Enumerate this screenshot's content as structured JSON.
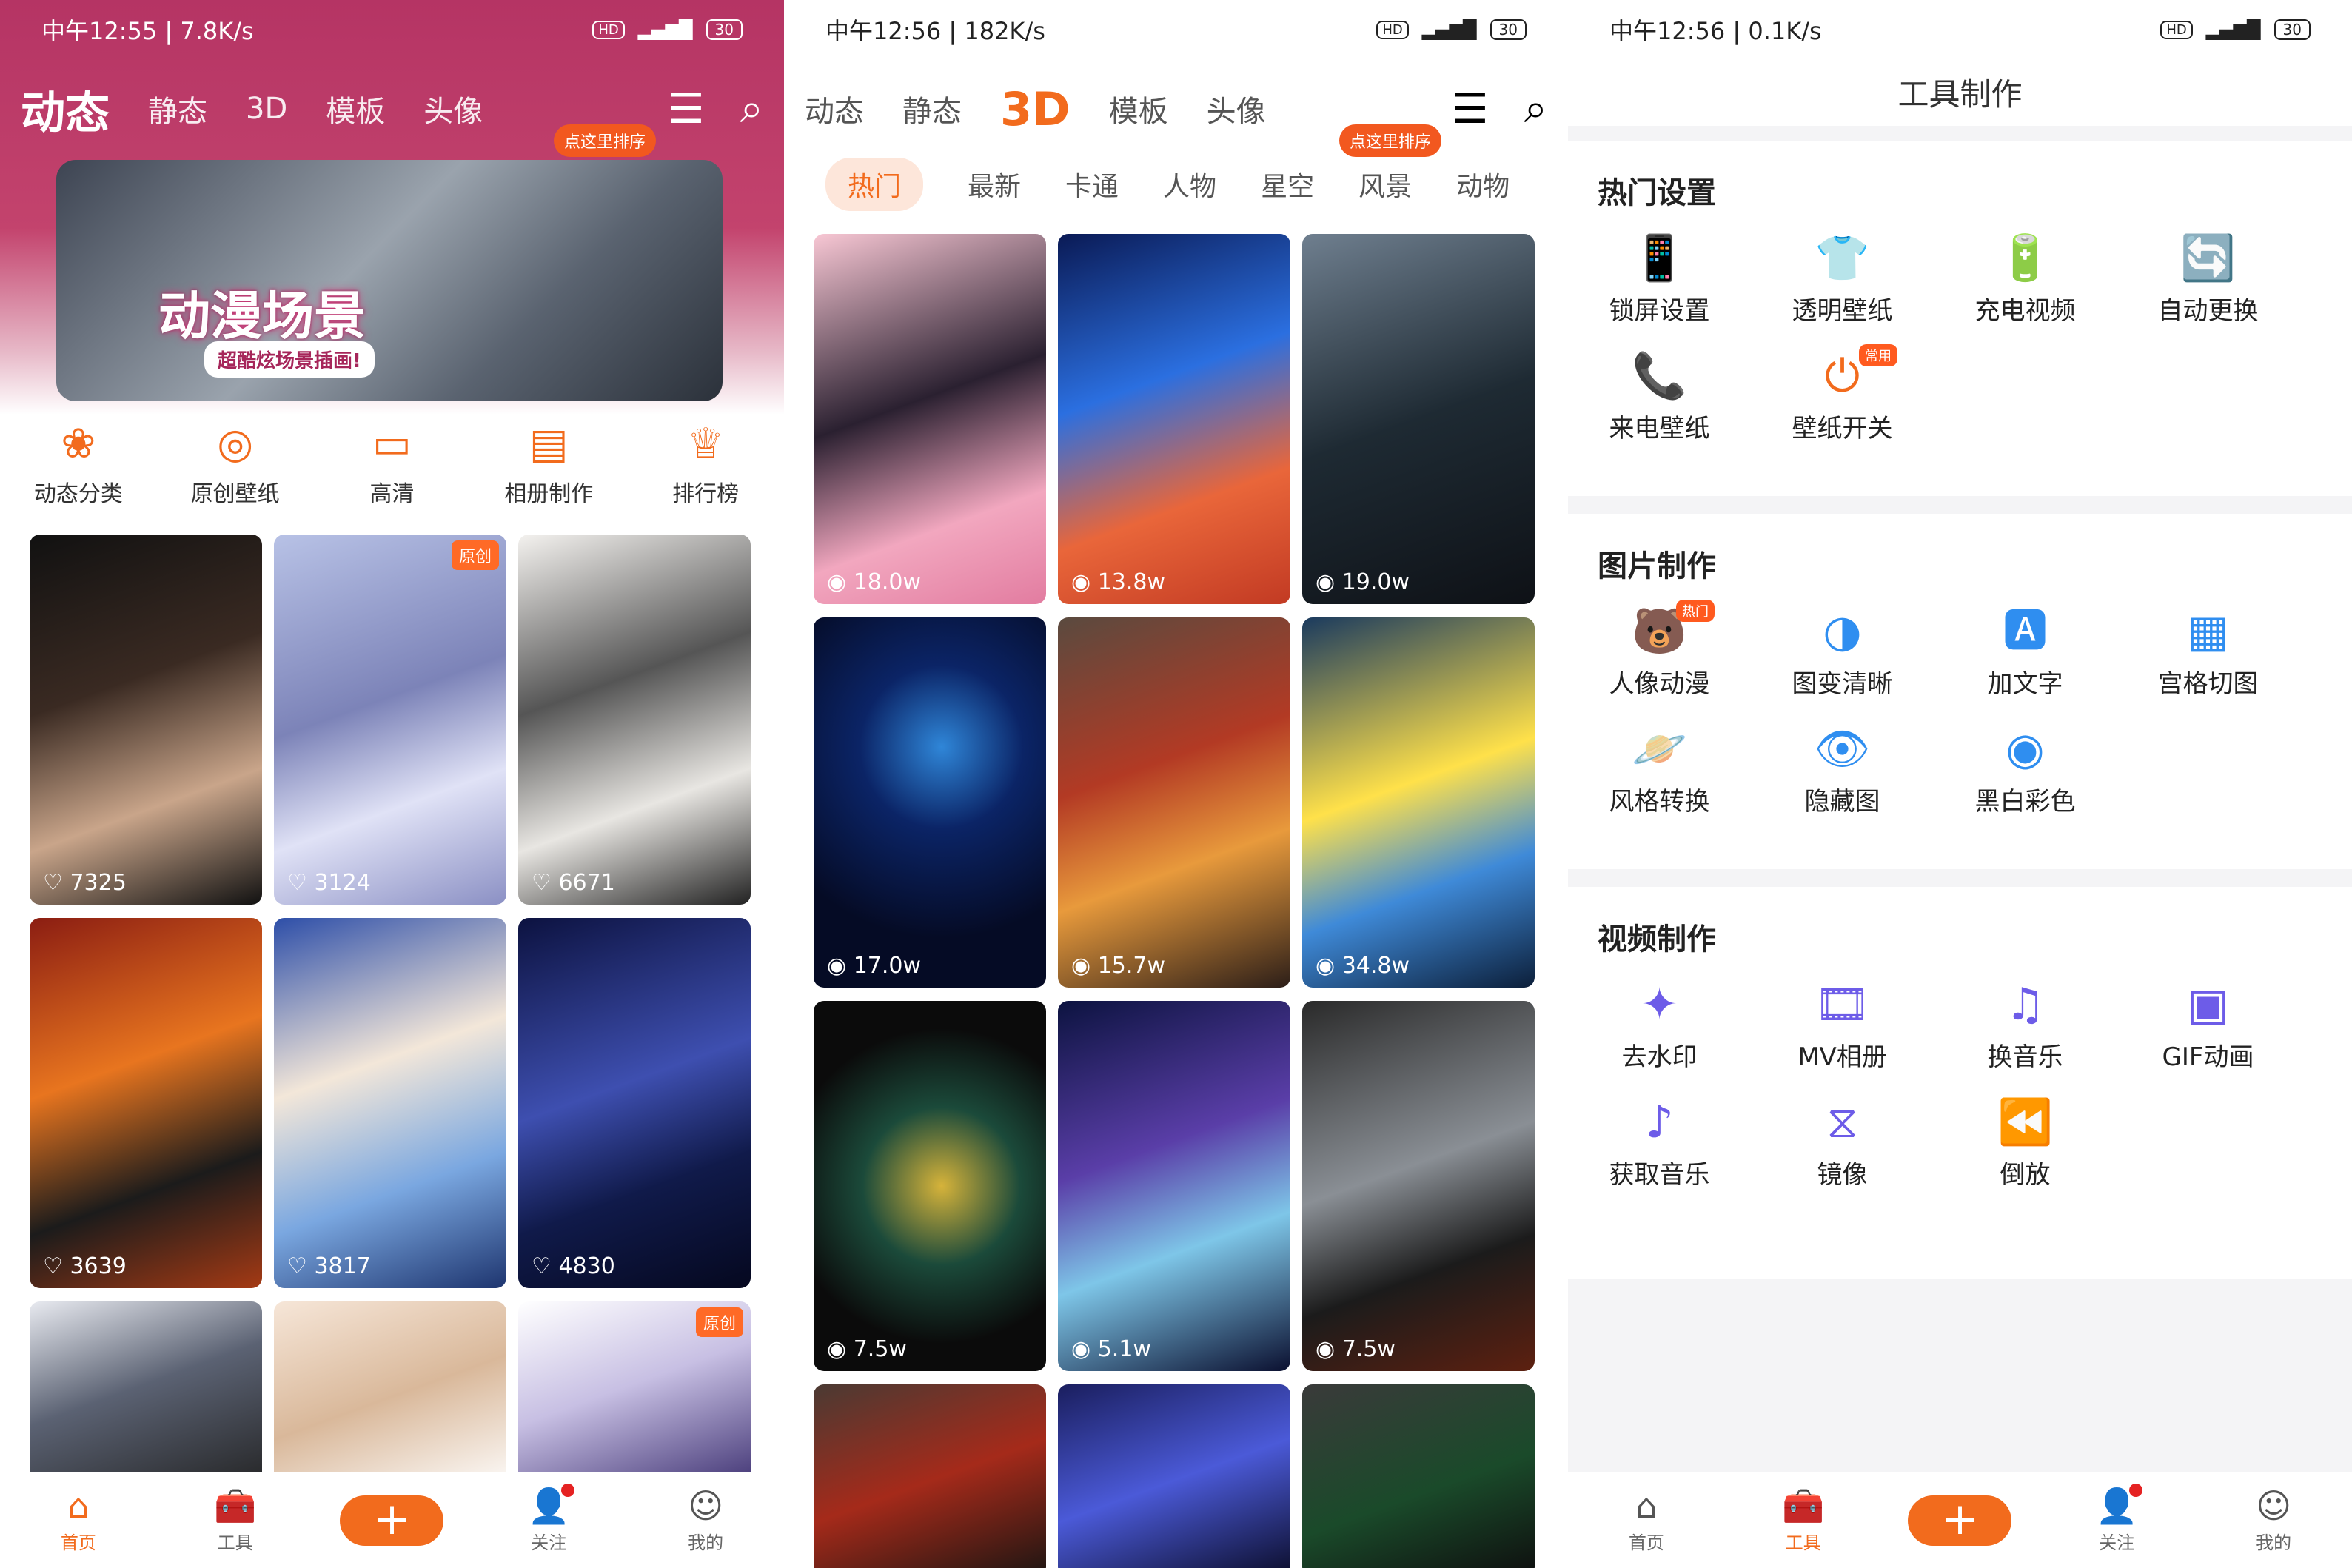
{
  "panel1": {
    "status": {
      "left": "中午12:55 | 7.8K/s",
      "battery": "30"
    },
    "tabs": [
      "动态",
      "静态",
      "3D",
      "模板",
      "头像"
    ],
    "sort_badge": "点这里排序",
    "banner": {
      "title": "动漫场景",
      "subtitle": "超酷炫场景插画!"
    },
    "categories": [
      {
        "label": "动态分类",
        "icon": "grid-icon"
      },
      {
        "label": "原创壁纸",
        "icon": "bulb-icon"
      },
      {
        "label": "高清",
        "icon": "hd-icon"
      },
      {
        "label": "相册制作",
        "icon": "film-icon"
      },
      {
        "label": "排行榜",
        "icon": "trophy-icon"
      }
    ],
    "cards": [
      {
        "likes": "7325",
        "original": "",
        "bg": "linear-gradient(160deg,#111,#3a2a22 40%,#c9a58a 70%,#111)"
      },
      {
        "likes": "3124",
        "original": "原创",
        "bg": "linear-gradient(160deg,#b8c2e6,#7c83b8 45%,#e0e2f6 70%,#8b90c4)"
      },
      {
        "likes": "6671",
        "original": "",
        "bg": "linear-gradient(160deg,#f4f2ef,#555 40%,#e8e6e2 70%,#222)"
      },
      {
        "likes": "3639",
        "original": "",
        "bg": "linear-gradient(160deg,#8b1d12,#e8751f 40%,#1b1b1b 70%,#a53a14)"
      },
      {
        "likes": "3817",
        "original": "",
        "bg": "linear-gradient(160deg,#2d4ea8,#f3e7d9 40%,#7aa7e0 70%,#1e356f)"
      },
      {
        "likes": "4830",
        "original": "",
        "bg": "linear-gradient(160deg,#0c1240,#3e4fb0 45%,#101a4a 70%,#05081f)"
      },
      {
        "likes": "",
        "original": "",
        "bg": "linear-gradient(160deg,#e8eaf0,#5b6273 45%,#222)"
      },
      {
        "likes": "",
        "original": "",
        "bg": "linear-gradient(160deg,#f6e6d8,#d9b89a 50%,#fff)"
      },
      {
        "likes": "",
        "original": "原创",
        "bg": "linear-gradient(160deg,#fff,#c7bfe3 45%,#3a2d6e)"
      }
    ]
  },
  "panel2": {
    "status": {
      "left": "中午12:56 | 182K/s",
      "battery": "30"
    },
    "tabs": [
      "动态",
      "静态",
      "3D",
      "模板",
      "头像"
    ],
    "sort_badge": "点这里排序",
    "subtabs": [
      "热门",
      "最新",
      "卡通",
      "人物",
      "星空",
      "风景",
      "动物"
    ],
    "cards": [
      {
        "views": "18.0w",
        "bg": "linear-gradient(160deg,#f8c7d4,#2a2030 45%,#f2a7bf 75%,#e27ca0)"
      },
      {
        "views": "13.8w",
        "bg": "linear-gradient(160deg,#0a1a55,#2b6fe0 40%,#e9663a 70%,#c23a23)"
      },
      {
        "views": "19.0w",
        "bg": "linear-gradient(160deg,#6f7f8f,#1e2a33 50%,#0e1116)"
      },
      {
        "views": "17.0w",
        "bg": "radial-gradient(circle at 55% 35%,#2f86d8 0%,#0b2466 30%,#050b25 70%)"
      },
      {
        "views": "15.7w",
        "bg": "linear-gradient(160deg,#5a4a3f,#b33a24 40%,#e89a3c 65%,#2c1e18)"
      },
      {
        "views": "34.8w",
        "bg": "linear-gradient(160deg,#1a3a5e,#ffe14a 45%,#3f8ad8 70%,#0c1f3a)"
      },
      {
        "views": "7.5w",
        "bg": "radial-gradient(circle at 55% 50%,#d6b33a 0%,#1b4a3a 35%,#0b0b0b 70%)"
      },
      {
        "views": "5.1w",
        "bg": "linear-gradient(160deg,#0c1340,#5a3ea8 40%,#7ec6e8 65%,#0b1030)"
      },
      {
        "views": "7.5w",
        "bg": "linear-gradient(160deg,#2a2a2a,#8a8f95 45%,#1b1b1b 70%,#5d2010)"
      },
      {
        "views": "",
        "bg": "linear-gradient(160deg,#4a3a33,#a52a1a 50%,#1c1512)"
      },
      {
        "views": "",
        "bg": "linear-gradient(160deg,#1a1e5e,#4b5ad8 50%,#0b0d2a)"
      },
      {
        "views": "",
        "bg": "linear-gradient(160deg,#3a3a3a,#1a4a2a 55%,#0e0e0e)"
      }
    ]
  },
  "panel3": {
    "status": {
      "left": "中午12:56 | 0.1K/s",
      "battery": "30"
    },
    "title": "工具制作",
    "sections": [
      {
        "heading": "热门设置",
        "items": [
          {
            "label": "锁屏设置",
            "icon": "phone-lock-icon",
            "glyph": "📱",
            "tag": ""
          },
          {
            "label": "透明壁纸",
            "icon": "shirt-icon",
            "glyph": "👕",
            "tag": ""
          },
          {
            "label": "充电视频",
            "icon": "battery-charge-icon",
            "glyph": "🔋",
            "tag": ""
          },
          {
            "label": "自动更换",
            "icon": "switch-icon",
            "glyph": "🔄",
            "tag": ""
          },
          {
            "label": "来电壁纸",
            "icon": "call-icon",
            "glyph": "📞",
            "tag": ""
          },
          {
            "label": "壁纸开关",
            "icon": "toggle-icon",
            "glyph": "⏻",
            "tag": "常用"
          }
        ]
      },
      {
        "heading": "图片制作",
        "items": [
          {
            "label": "人像动漫",
            "icon": "bear-icon",
            "glyph": "🐻",
            "tag": "热门"
          },
          {
            "label": "图变清晰",
            "icon": "half-circle-icon",
            "glyph": "◑",
            "tag": ""
          },
          {
            "label": "加文字",
            "icon": "text-a-icon",
            "glyph": "🅰",
            "tag": ""
          },
          {
            "label": "宫格切图",
            "icon": "grid4-icon",
            "glyph": "▦",
            "tag": ""
          },
          {
            "label": "风格转换",
            "icon": "planet-icon",
            "glyph": "🪐",
            "tag": ""
          },
          {
            "label": "隐藏图",
            "icon": "eye-hide-icon",
            "glyph": "👁",
            "tag": ""
          },
          {
            "label": "黑白彩色",
            "icon": "color-circle-icon",
            "glyph": "◉",
            "tag": ""
          }
        ]
      },
      {
        "heading": "视频制作",
        "items": [
          {
            "label": "去水印",
            "icon": "sparkle-icon",
            "glyph": "✦",
            "tag": ""
          },
          {
            "label": "MV相册",
            "icon": "film-strip-icon",
            "glyph": "🎞",
            "tag": ""
          },
          {
            "label": "换音乐",
            "icon": "music-note-icon",
            "glyph": "♫",
            "tag": ""
          },
          {
            "label": "GIF动画",
            "icon": "gif-icon",
            "glyph": "▣",
            "tag": ""
          },
          {
            "label": "获取音乐",
            "icon": "music-fetch-icon",
            "glyph": "♪",
            "tag": ""
          },
          {
            "label": "镜像",
            "icon": "mirror-icon",
            "glyph": "⧖",
            "tag": ""
          },
          {
            "label": "倒放",
            "icon": "rewind-icon",
            "glyph": "⏪",
            "tag": ""
          }
        ]
      }
    ]
  },
  "bottomnav": [
    {
      "label": "首页",
      "icon": "home-icon",
      "glyph": "⌂"
    },
    {
      "label": "工具",
      "icon": "toolbox-icon",
      "glyph": "🧰"
    },
    {
      "label": "",
      "icon": "plus-icon",
      "glyph": "+"
    },
    {
      "label": "关注",
      "icon": "follow-icon",
      "glyph": "👤"
    },
    {
      "label": "我的",
      "icon": "face-icon",
      "glyph": "☺"
    }
  ],
  "colors": {
    "accent": "#f26b1d",
    "brand": "#b53464"
  }
}
